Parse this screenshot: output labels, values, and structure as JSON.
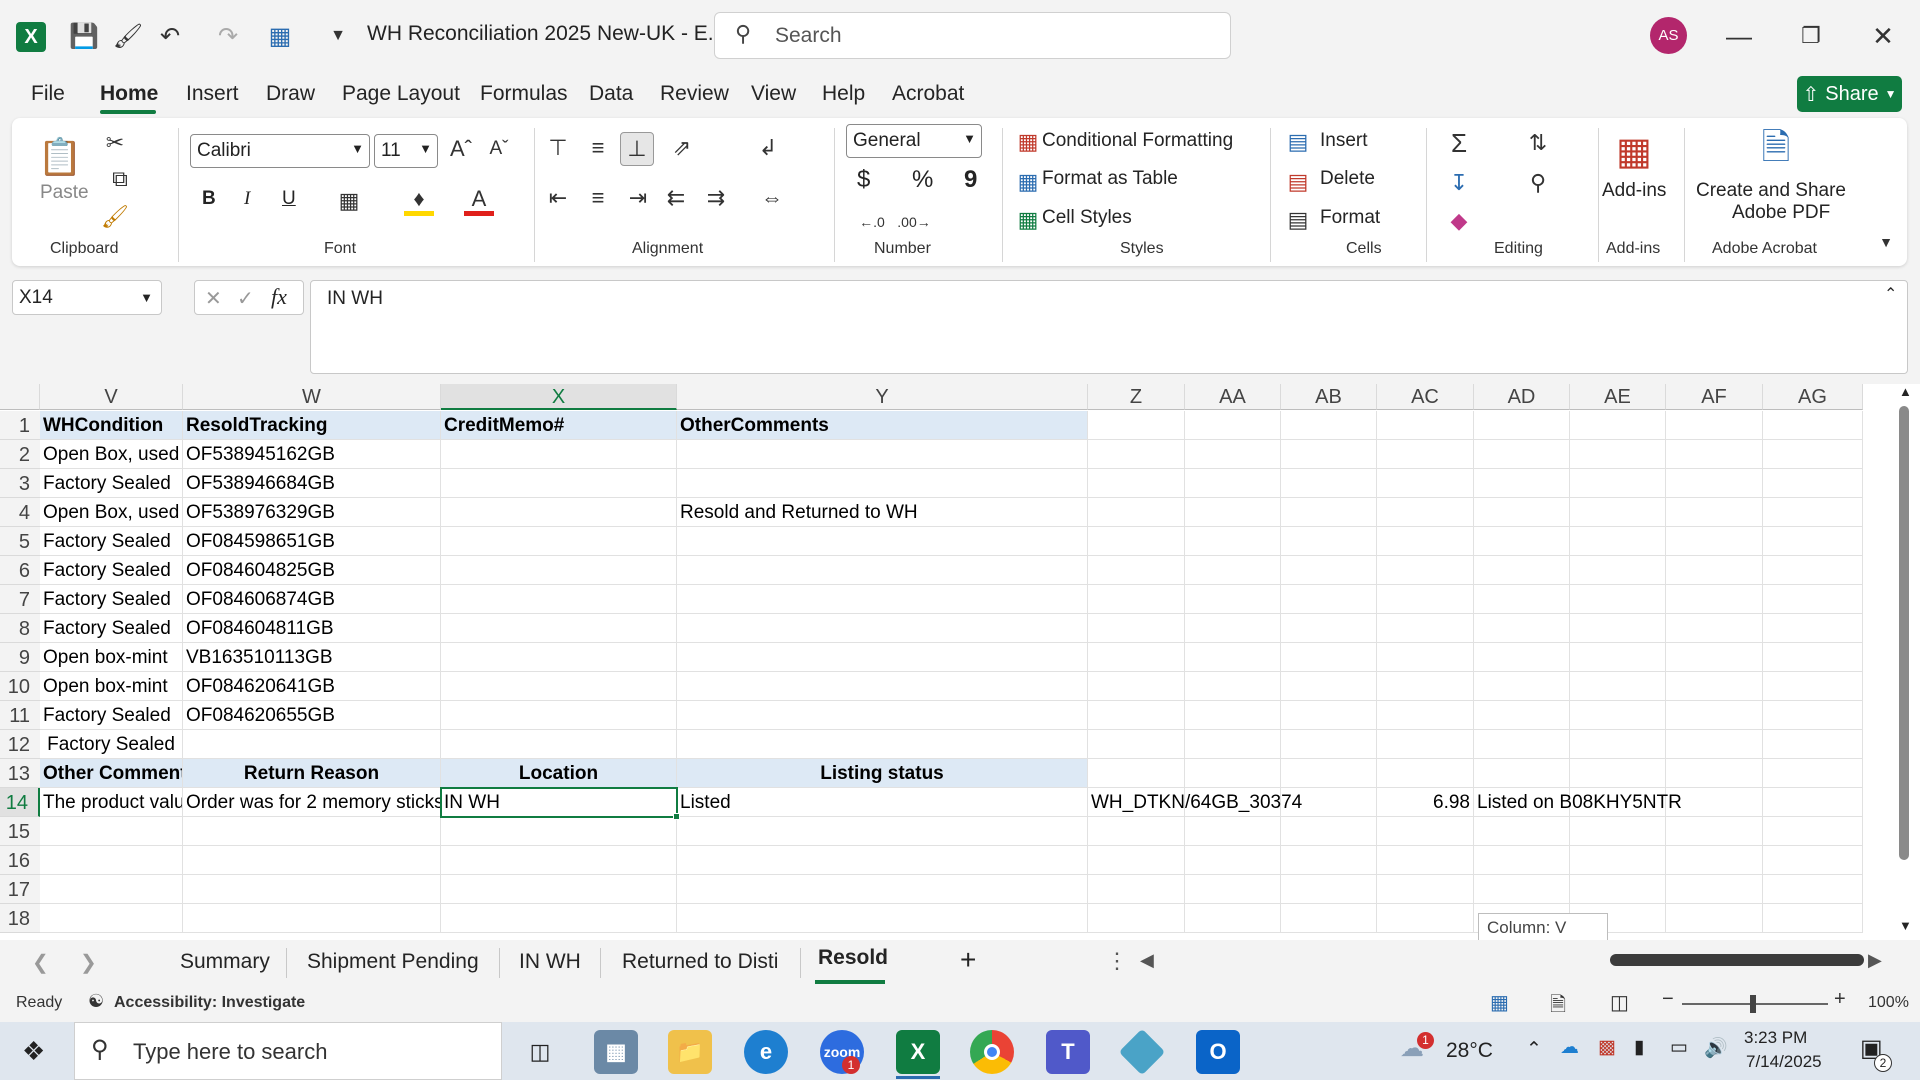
{
  "titlebar": {
    "doc_title": "WH Reconciliation 2025 New-UK  -  E...",
    "search_placeholder": "Search",
    "avatar_initials": "AS"
  },
  "menu": [
    "File",
    "Home",
    "Insert",
    "Draw",
    "Page Layout",
    "Formulas",
    "Data",
    "Review",
    "View",
    "Help",
    "Acrobat"
  ],
  "share_label": "Share",
  "ribbon": {
    "clipboard": {
      "label": "Clipboard",
      "paste": "Paste"
    },
    "font": {
      "label": "Font",
      "font_name": "Calibri",
      "font_size": "11",
      "bold": "B",
      "italic": "I",
      "underline": "U"
    },
    "alignment": {
      "label": "Alignment"
    },
    "number": {
      "label": "Number",
      "format": "General",
      "currency": "$",
      "percent": "%",
      "comma": "9"
    },
    "styles": {
      "label": "Styles",
      "conditional": "Conditional Formatting",
      "format_table": "Format as Table",
      "cell_styles": "Cell Styles"
    },
    "cells": {
      "label": "Cells",
      "insert": "Insert",
      "delete": "Delete",
      "format": "Format"
    },
    "editing": {
      "label": "Editing"
    },
    "addins": {
      "label": "Add-ins",
      "button": "Add-ins"
    },
    "acrobat": {
      "label": "Adobe Acrobat",
      "button_line1": "Create and Share",
      "button_line2": "Adobe PDF"
    }
  },
  "formula": {
    "name_box": "X14",
    "value": "IN WH"
  },
  "columns": [
    "V",
    "W",
    "X",
    "Y",
    "Z",
    "AA",
    "AB",
    "AC",
    "AD",
    "AE",
    "AF",
    "AG"
  ],
  "rows": [
    {
      "n": "1",
      "V": "WHCondition",
      "W": "ResoldTracking",
      "X": "CreditMemo#",
      "Y": "OtherComments"
    },
    {
      "n": "2",
      "V": "Open Box, used",
      "W": "OF538945162GB"
    },
    {
      "n": "3",
      "V": "Factory Sealed",
      "W": "OF538946684GB"
    },
    {
      "n": "4",
      "V": "Open Box, used",
      "W": "OF538976329GB",
      "Y": "Resold and Returned to WH"
    },
    {
      "n": "5",
      "V": "Factory Sealed",
      "W": "OF084598651GB"
    },
    {
      "n": "6",
      "V": "Factory Sealed",
      "W": "OF084604825GB"
    },
    {
      "n": "7",
      "V": "Factory Sealed",
      "W": "OF084606874GB"
    },
    {
      "n": "8",
      "V": "Factory Sealed",
      "W": "OF084604811GB"
    },
    {
      "n": "9",
      "V": "Open box-mint",
      "W": "VB163510113GB"
    },
    {
      "n": "10",
      "V": "Open box-mint",
      "W": "OF084620641GB"
    },
    {
      "n": "11",
      "V": "Factory Sealed",
      "W": "OF084620655GB"
    },
    {
      "n": "12",
      "V": "Factory Sealed"
    },
    {
      "n": "13",
      "V": "Other Comment",
      "W": "Return Reason",
      "X": "Location",
      "Y": "Listing status"
    },
    {
      "n": "14",
      "V": "The product valu",
      "W": "Order was for 2 memory sticks",
      "X": "IN WH",
      "Y": "Listed",
      "Z": "WH_DTKN/64GB_30374",
      "AC": "6.98",
      "AD": "Listed on B08KHY5NTR"
    },
    {
      "n": "15"
    },
    {
      "n": "16"
    },
    {
      "n": "17"
    },
    {
      "n": "18"
    }
  ],
  "tooltip": "Column: V",
  "sheet_tabs": [
    "Summary",
    "Shipment Pending",
    "IN WH",
    "Returned to Disti",
    "Resold"
  ],
  "active_tab": "Resold",
  "status": {
    "ready": "Ready",
    "accessibility": "Accessibility: Investigate",
    "zoom": "100%"
  },
  "taskbar": {
    "search_placeholder": "Type here to search",
    "weather": "28°C",
    "time": "3:23 PM",
    "date": "7/14/2025",
    "weather_badge": "1",
    "zoom_badge": "1",
    "notif_badge": "2"
  }
}
